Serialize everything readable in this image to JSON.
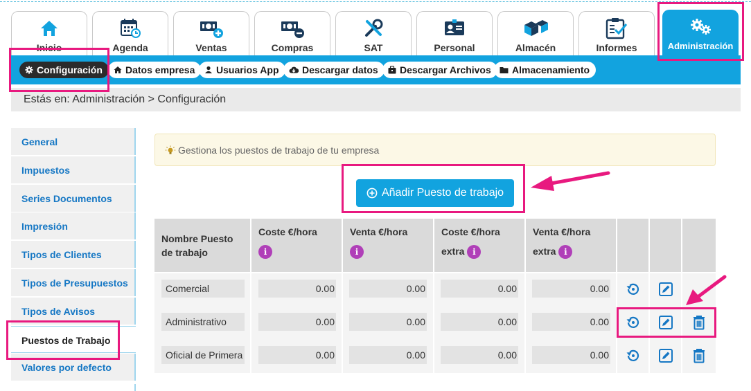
{
  "modules": [
    {
      "label": "Inicio",
      "icon": "home-icon"
    },
    {
      "label": "Agenda",
      "icon": "calendar-icon"
    },
    {
      "label": "Ventas",
      "icon": "money-plus-icon"
    },
    {
      "label": "Compras",
      "icon": "money-minus-icon"
    },
    {
      "label": "SAT",
      "icon": "tools-icon"
    },
    {
      "label": "Personal",
      "icon": "id-card-icon"
    },
    {
      "label": "Almacén",
      "icon": "boxes-icon"
    },
    {
      "label": "Informes",
      "icon": "clipboard-icon"
    },
    {
      "label": "Administración",
      "icon": "gears-icon"
    }
  ],
  "subnav": [
    {
      "label": "Configuración",
      "icon": "gear-icon"
    },
    {
      "label": "Datos empresa",
      "icon": "home-icon"
    },
    {
      "label": "Usuarios App",
      "icon": "user-icon"
    },
    {
      "label": "Descargar datos",
      "icon": "cloud-download-icon"
    },
    {
      "label": "Descargar Archivos",
      "icon": "briefcase-icon"
    },
    {
      "label": "Almacenamiento",
      "icon": "folder-icon"
    }
  ],
  "breadcrumb": "Estás en: Administración > Configuración",
  "side_menu": [
    "General",
    "Impuestos",
    "Series Documentos",
    "Impresión",
    "Tipos de Clientes",
    "Tipos de Presupuestos",
    "Tipos de Avisos",
    "Puestos de Trabajo",
    "Valores por defecto"
  ],
  "notice": "Gestiona los puestos de trabajo de tu empresa",
  "add_button": "Añadir Puesto de trabajo",
  "table": {
    "headers": [
      {
        "line1": "Nombre Puesto",
        "line2": "de trabajo"
      },
      {
        "line1": "Coste €/hora",
        "line2": ""
      },
      {
        "line1": "Venta €/hora",
        "line2": ""
      },
      {
        "line1": "Coste €/hora",
        "line2": "extra"
      },
      {
        "line1": "Venta €/hora",
        "line2": "extra"
      }
    ],
    "info_glyph": "i",
    "rows": [
      {
        "name": "Comercial",
        "values": [
          "0.00",
          "0.00",
          "0.00",
          "0.00"
        ],
        "deletable": false
      },
      {
        "name": "Administrativo",
        "values": [
          "0.00",
          "0.00",
          "0.00",
          "0.00"
        ],
        "deletable": true
      },
      {
        "name": "Oficial de Primera",
        "values": [
          "0.00",
          "0.00",
          "0.00",
          "0.00"
        ],
        "deletable": true
      }
    ]
  },
  "colors": {
    "primary": "#12a3df",
    "link": "#1577c4",
    "info": "#b03fb8",
    "highlight": "#e8197f",
    "active_pill": "#2b2b2b"
  }
}
